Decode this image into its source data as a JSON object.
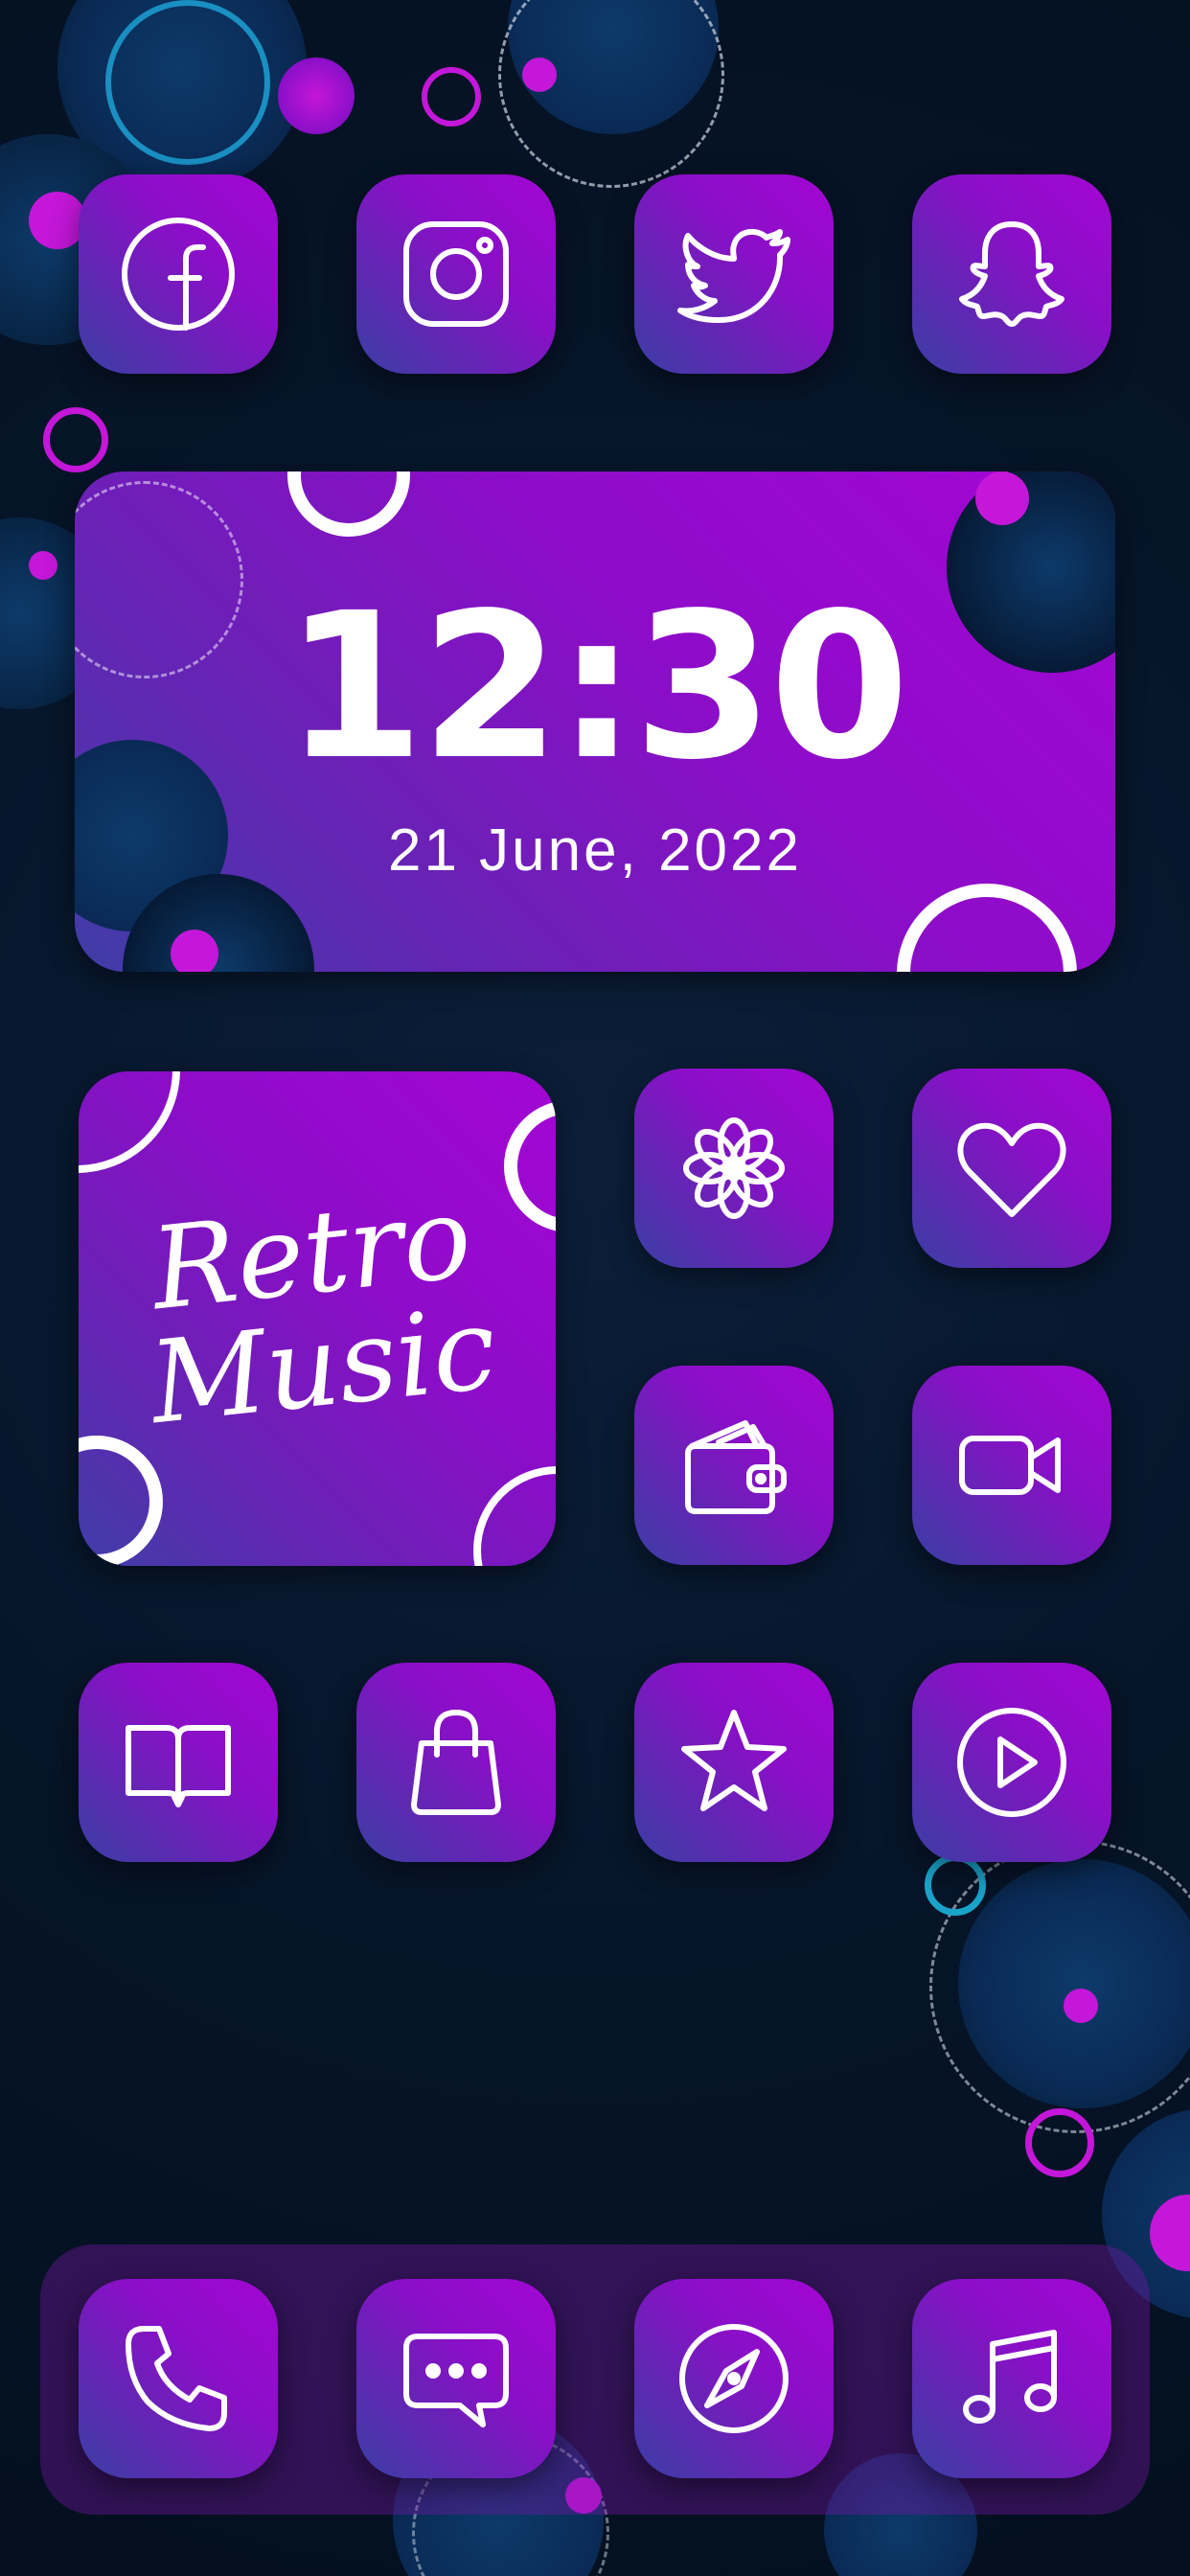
{
  "clock": {
    "time": "12:30",
    "date": "21 June, 2022"
  },
  "music_widget": {
    "line1": "Retro",
    "line2": "Music"
  },
  "colors": {
    "background": "#061428",
    "tile_gradient_start": "#a306d4",
    "tile_gradient_end": "#3a3fa5",
    "icon_stroke": "#ffffff",
    "accent_cyan": "#1aa3c9",
    "accent_magenta": "#c417d9"
  },
  "apps": {
    "row1": [
      {
        "icon": "facebook-icon"
      },
      {
        "icon": "instagram-icon"
      },
      {
        "icon": "twitter-icon"
      },
      {
        "icon": "snapchat-icon"
      }
    ],
    "row_mid": [
      {
        "icon": "flower-icon"
      },
      {
        "icon": "heart-icon"
      },
      {
        "icon": "wallet-icon"
      },
      {
        "icon": "video-camera-icon"
      }
    ],
    "row4": [
      {
        "icon": "book-icon"
      },
      {
        "icon": "shopping-bag-icon"
      },
      {
        "icon": "star-icon"
      },
      {
        "icon": "play-icon"
      }
    ],
    "dock": [
      {
        "icon": "phone-icon"
      },
      {
        "icon": "messages-icon"
      },
      {
        "icon": "compass-icon"
      },
      {
        "icon": "music-note-icon"
      }
    ]
  }
}
